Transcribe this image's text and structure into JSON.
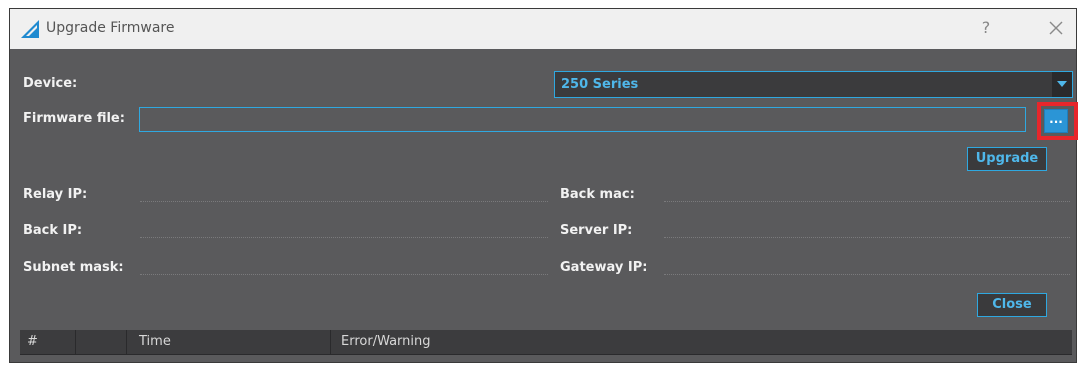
{
  "window": {
    "title": "Upgrade Firmware",
    "help_label": "?"
  },
  "form": {
    "device_label": "Device:",
    "device_value": "250 Series",
    "firmware_label": "Firmware file:",
    "firmware_value": "",
    "browse_label": "...",
    "upgrade_label": "Upgrade",
    "close_label": "Close"
  },
  "info": {
    "relay_ip_label": "Relay IP:",
    "back_ip_label": "Back IP:",
    "subnet_mask_label": "Subnet mask:",
    "back_mac_label": "Back mac:",
    "server_ip_label": "Server IP:",
    "gateway_ip_label": "Gateway IP:"
  },
  "grid": {
    "columns": [
      "#",
      "",
      "Time",
      "Error/Warning"
    ]
  },
  "colors": {
    "accent": "#2fa8e0",
    "panel": "#5a5a5c",
    "highlight": "#e8262b"
  },
  "icons": {
    "app": "app-logo-icon",
    "close": "close-icon",
    "dropdown": "chevron-down-icon"
  }
}
